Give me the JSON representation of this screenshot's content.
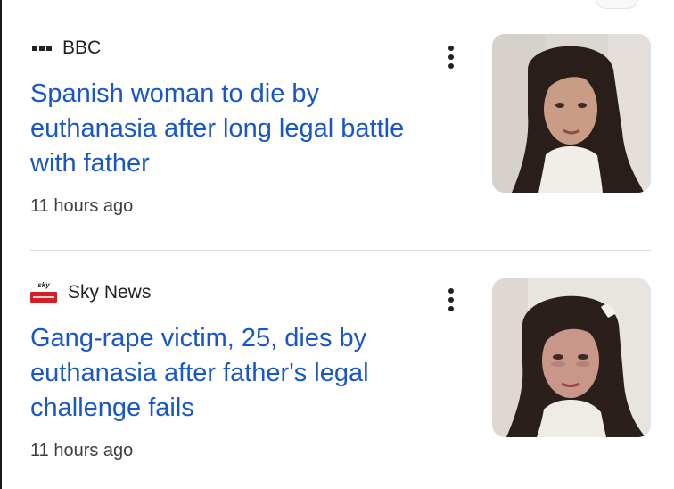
{
  "articles": [
    {
      "source": "BBC",
      "logo_icon": "bbc-logo-icon",
      "headline": "Spanish woman to die by euthanasia after long legal battle with father",
      "time": "11 hours ago",
      "menu_icon": "more-vert-icon",
      "thumbnail": "woman-portrait-photo"
    },
    {
      "source": "Sky News",
      "logo_icon": "sky-news-logo-icon",
      "logo_text": "sky",
      "headline": "Gang-rape victim, 25, dies by euthanasia after father's legal challenge fails",
      "time": "11 hours ago",
      "menu_icon": "more-vert-icon",
      "thumbnail": "woman-portrait-photo"
    }
  ],
  "colors": {
    "headline": "#1a57c6",
    "source_text": "#202124",
    "timestamp": "#3c4043",
    "divider": "#dadce0",
    "sky_red": "#d41f26"
  }
}
